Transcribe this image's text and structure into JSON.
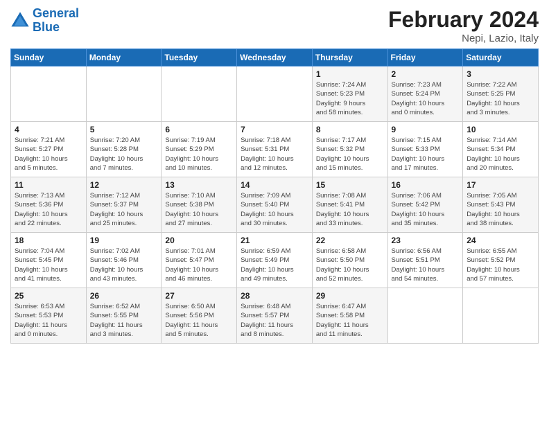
{
  "logo": {
    "line1": "General",
    "line2": "Blue"
  },
  "title": "February 2024",
  "location": "Nepi, Lazio, Italy",
  "days_of_week": [
    "Sunday",
    "Monday",
    "Tuesday",
    "Wednesday",
    "Thursday",
    "Friday",
    "Saturday"
  ],
  "weeks": [
    [
      {
        "num": "",
        "info": ""
      },
      {
        "num": "",
        "info": ""
      },
      {
        "num": "",
        "info": ""
      },
      {
        "num": "",
        "info": ""
      },
      {
        "num": "1",
        "info": "Sunrise: 7:24 AM\nSunset: 5:23 PM\nDaylight: 9 hours\nand 58 minutes."
      },
      {
        "num": "2",
        "info": "Sunrise: 7:23 AM\nSunset: 5:24 PM\nDaylight: 10 hours\nand 0 minutes."
      },
      {
        "num": "3",
        "info": "Sunrise: 7:22 AM\nSunset: 5:25 PM\nDaylight: 10 hours\nand 3 minutes."
      }
    ],
    [
      {
        "num": "4",
        "info": "Sunrise: 7:21 AM\nSunset: 5:27 PM\nDaylight: 10 hours\nand 5 minutes."
      },
      {
        "num": "5",
        "info": "Sunrise: 7:20 AM\nSunset: 5:28 PM\nDaylight: 10 hours\nand 7 minutes."
      },
      {
        "num": "6",
        "info": "Sunrise: 7:19 AM\nSunset: 5:29 PM\nDaylight: 10 hours\nand 10 minutes."
      },
      {
        "num": "7",
        "info": "Sunrise: 7:18 AM\nSunset: 5:31 PM\nDaylight: 10 hours\nand 12 minutes."
      },
      {
        "num": "8",
        "info": "Sunrise: 7:17 AM\nSunset: 5:32 PM\nDaylight: 10 hours\nand 15 minutes."
      },
      {
        "num": "9",
        "info": "Sunrise: 7:15 AM\nSunset: 5:33 PM\nDaylight: 10 hours\nand 17 minutes."
      },
      {
        "num": "10",
        "info": "Sunrise: 7:14 AM\nSunset: 5:34 PM\nDaylight: 10 hours\nand 20 minutes."
      }
    ],
    [
      {
        "num": "11",
        "info": "Sunrise: 7:13 AM\nSunset: 5:36 PM\nDaylight: 10 hours\nand 22 minutes."
      },
      {
        "num": "12",
        "info": "Sunrise: 7:12 AM\nSunset: 5:37 PM\nDaylight: 10 hours\nand 25 minutes."
      },
      {
        "num": "13",
        "info": "Sunrise: 7:10 AM\nSunset: 5:38 PM\nDaylight: 10 hours\nand 27 minutes."
      },
      {
        "num": "14",
        "info": "Sunrise: 7:09 AM\nSunset: 5:40 PM\nDaylight: 10 hours\nand 30 minutes."
      },
      {
        "num": "15",
        "info": "Sunrise: 7:08 AM\nSunset: 5:41 PM\nDaylight: 10 hours\nand 33 minutes."
      },
      {
        "num": "16",
        "info": "Sunrise: 7:06 AM\nSunset: 5:42 PM\nDaylight: 10 hours\nand 35 minutes."
      },
      {
        "num": "17",
        "info": "Sunrise: 7:05 AM\nSunset: 5:43 PM\nDaylight: 10 hours\nand 38 minutes."
      }
    ],
    [
      {
        "num": "18",
        "info": "Sunrise: 7:04 AM\nSunset: 5:45 PM\nDaylight: 10 hours\nand 41 minutes."
      },
      {
        "num": "19",
        "info": "Sunrise: 7:02 AM\nSunset: 5:46 PM\nDaylight: 10 hours\nand 43 minutes."
      },
      {
        "num": "20",
        "info": "Sunrise: 7:01 AM\nSunset: 5:47 PM\nDaylight: 10 hours\nand 46 minutes."
      },
      {
        "num": "21",
        "info": "Sunrise: 6:59 AM\nSunset: 5:49 PM\nDaylight: 10 hours\nand 49 minutes."
      },
      {
        "num": "22",
        "info": "Sunrise: 6:58 AM\nSunset: 5:50 PM\nDaylight: 10 hours\nand 52 minutes."
      },
      {
        "num": "23",
        "info": "Sunrise: 6:56 AM\nSunset: 5:51 PM\nDaylight: 10 hours\nand 54 minutes."
      },
      {
        "num": "24",
        "info": "Sunrise: 6:55 AM\nSunset: 5:52 PM\nDaylight: 10 hours\nand 57 minutes."
      }
    ],
    [
      {
        "num": "25",
        "info": "Sunrise: 6:53 AM\nSunset: 5:53 PM\nDaylight: 11 hours\nand 0 minutes."
      },
      {
        "num": "26",
        "info": "Sunrise: 6:52 AM\nSunset: 5:55 PM\nDaylight: 11 hours\nand 3 minutes."
      },
      {
        "num": "27",
        "info": "Sunrise: 6:50 AM\nSunset: 5:56 PM\nDaylight: 11 hours\nand 5 minutes."
      },
      {
        "num": "28",
        "info": "Sunrise: 6:48 AM\nSunset: 5:57 PM\nDaylight: 11 hours\nand 8 minutes."
      },
      {
        "num": "29",
        "info": "Sunrise: 6:47 AM\nSunset: 5:58 PM\nDaylight: 11 hours\nand 11 minutes."
      },
      {
        "num": "",
        "info": ""
      },
      {
        "num": "",
        "info": ""
      }
    ]
  ]
}
